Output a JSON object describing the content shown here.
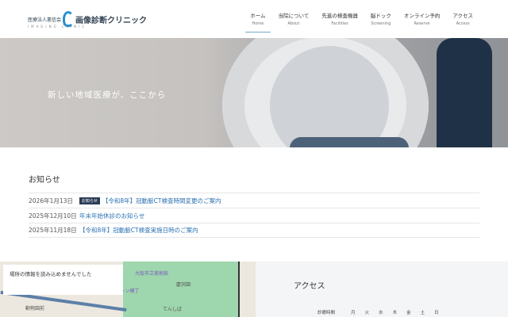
{
  "header": {
    "logo": {
      "prefix": "医療法人悪信会",
      "name": "画像診断クリニック",
      "sub": "IMAGING CLINIC"
    },
    "nav": [
      {
        "ja": "ホーム",
        "en": "Home"
      },
      {
        "ja": "当院について",
        "en": "About"
      },
      {
        "ja": "先進の検査機器",
        "en": "Facilities"
      },
      {
        "ja": "脳ドック",
        "en": "Screening"
      },
      {
        "ja": "オンライン予約",
        "en": "Reserve"
      },
      {
        "ja": "アクセス",
        "en": "Access"
      }
    ]
  },
  "hero": {
    "tagline": "新しい地域医療が、ここから"
  },
  "news": {
    "heading": "お知らせ",
    "items": [
      {
        "date": "2026年1月13日",
        "badge": "お知らせ",
        "title": "【令和8年】冠動脈CT検査時間変更のご案内"
      },
      {
        "date": "2025年12月10日",
        "title": "年末年始休診のお知らせ"
      },
      {
        "date": "2025年11月18日",
        "title": "【令和8年】冠動脈CT検査実施日時のご案内"
      }
    ]
  },
  "map": {
    "error": "場所の情報を読み込めませんでした",
    "labels": [
      "大阪市立美術館",
      "慶沢園",
      "ジャンジャン横丁",
      "てんしば",
      "動物園前"
    ]
  },
  "access": {
    "heading": "アクセス",
    "hours_label": "診療時間",
    "days": [
      "月",
      "火",
      "水",
      "木",
      "金",
      "土",
      "日"
    ]
  }
}
